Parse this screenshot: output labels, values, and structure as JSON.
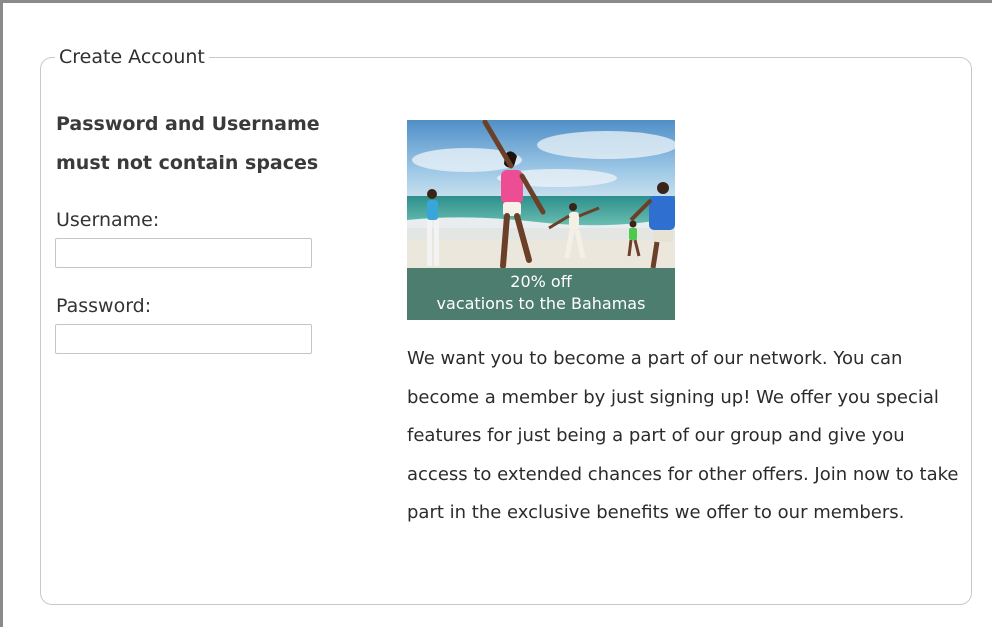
{
  "form": {
    "legend": "Create Account",
    "rules_line1": "Password and Username",
    "rules_line2": "must not contain spaces",
    "username_label": "Username:",
    "username_value": "",
    "password_label": "Password:",
    "password_value": ""
  },
  "promo": {
    "caption_line1": "20% off",
    "caption_line2": "vacations to the Bahamas",
    "caption_bg": "#4d7d6e"
  },
  "intro": {
    "text": "We want you to become a part of our network. You can become a member by just signing up! We offer you special features for just being a part of our group and give you access to extended chances for other offers. Join now to take part in the exclusive benefits we offer to our members."
  }
}
